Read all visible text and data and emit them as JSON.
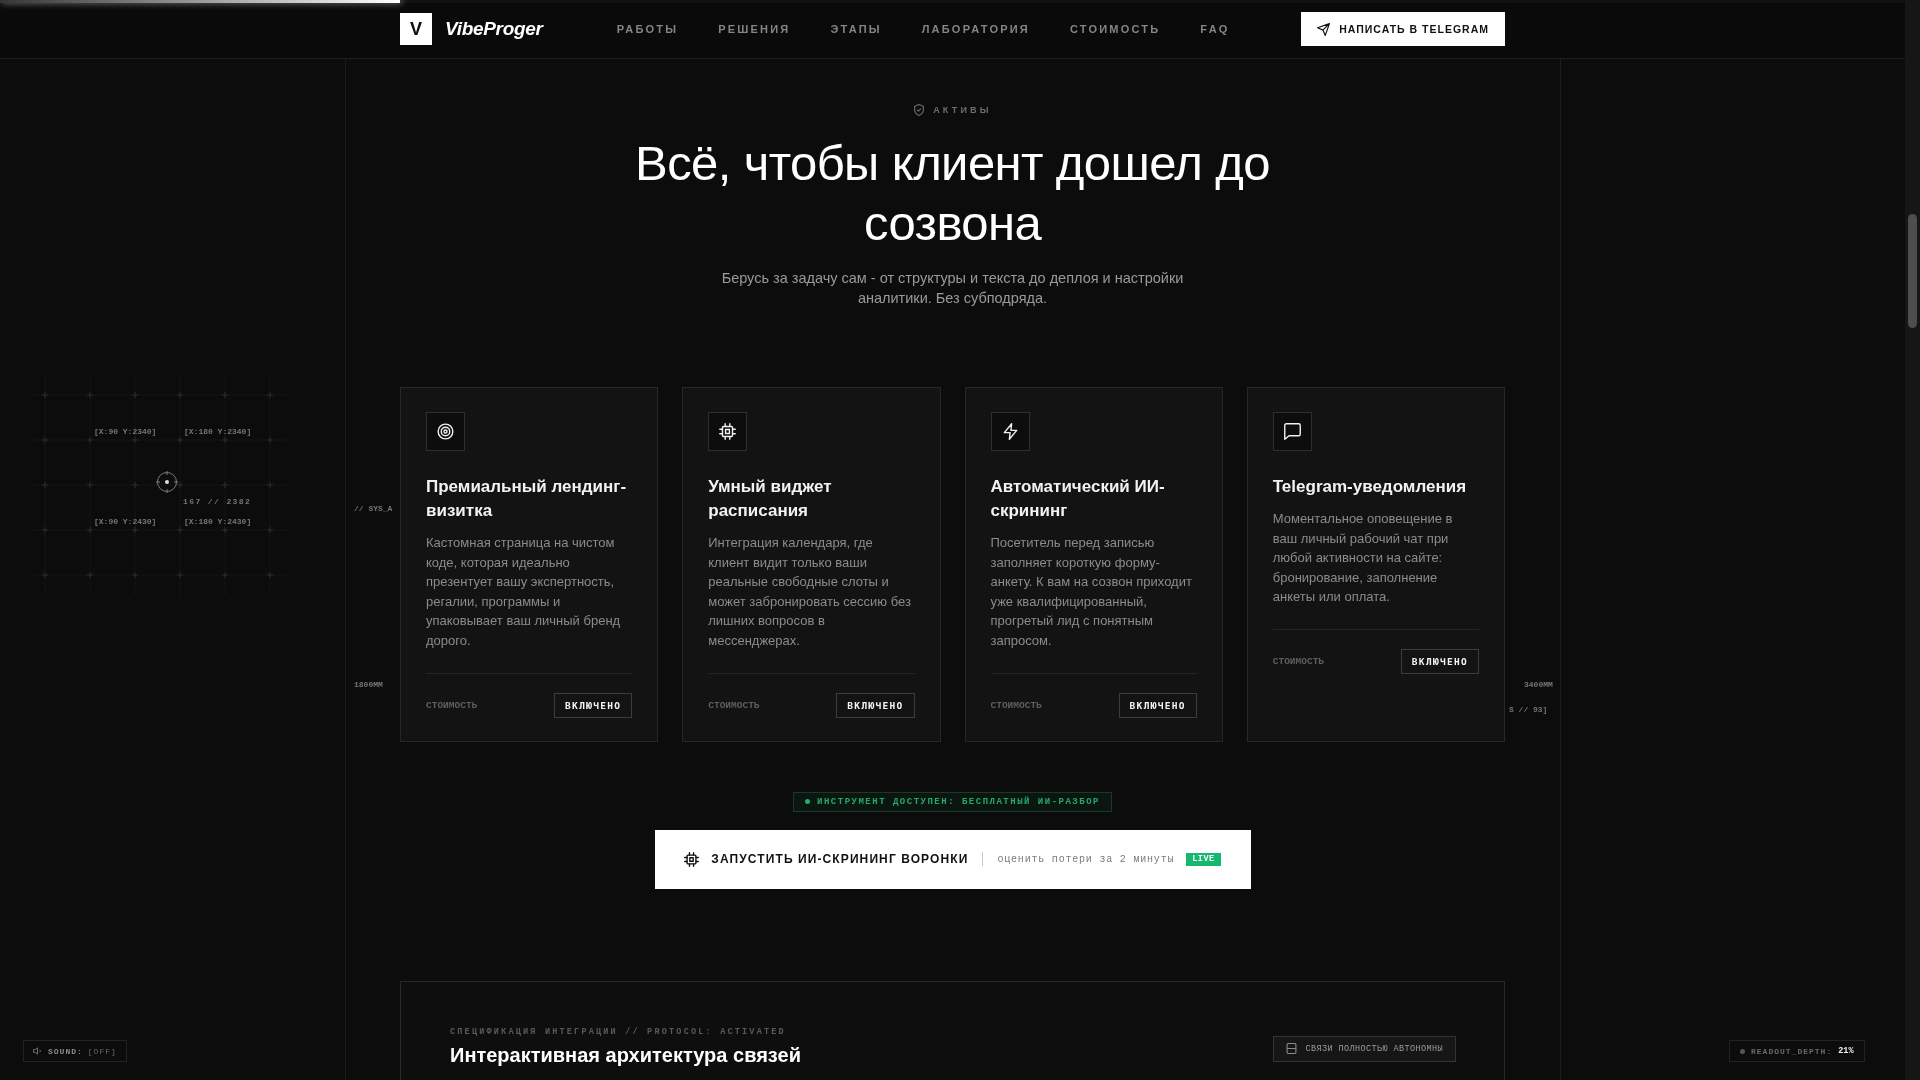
{
  "scroll_progress": {
    "level": 0.21
  },
  "header": {
    "logo_letter": "V",
    "brand": "VibeProger",
    "nav": [
      {
        "label": "РАБОТЫ"
      },
      {
        "label": "РЕШЕНИЯ"
      },
      {
        "label": "ЭТАПЫ"
      },
      {
        "label": "ЛАБОРАТОРИЯ"
      },
      {
        "label": "СТОИМОСТЬ"
      },
      {
        "label": "FAQ"
      }
    ],
    "cta": "НАПИСАТЬ В TELEGRAM"
  },
  "hud": {
    "coordinates": [
      "[X:90 Y:2340]",
      "[X:180 Y:2340]",
      "[X:90 Y:2430]",
      "[X:180 Y:2430]"
    ],
    "cursor_readout": "167 // 2382",
    "left_tag": "// SYS_A",
    "left_ruler": "1800MM",
    "right_ruler": "3400MM",
    "right_tag": "S // 93]"
  },
  "section": {
    "eyebrow": "АКТИВЫ",
    "title": "Всё, чтобы клиент дошел до созвона",
    "subtitle": "Берусь за задачу сам - от структуры и текста до деплоя и настройки аналитики. Без субподряда.",
    "cards": [
      {
        "title": "Премиальный лендинг-визитка",
        "description": "Кастомная страница на чистом коде, которая идеально презентует вашу экспертность, регалии, программы и упаковывает ваш личный бренд дорого.",
        "price_label": "СТОИМОСТЬ",
        "price": "ВКЛЮЧЕНО"
      },
      {
        "title": "Умный виджет расписания",
        "description": "Интеграция календаря, где клиент видит только ваши реальные свободные слоты и может забронировать сессию без лишних вопросов в мессенджерах.",
        "price_label": "СТОИМОСТЬ",
        "price": "ВКЛЮЧЕНО"
      },
      {
        "title": "Автоматический ИИ-скрининг",
        "description": "Посетитель перед записью заполняет короткую форму-анкету. К вам на созвон приходит уже квалифицированный, прогретый лид с понятным запросом.",
        "price_label": "СТОИМОСТЬ",
        "price": "ВКЛЮЧЕНО"
      },
      {
        "title": "Telegram-уведомления",
        "description": "Моментальное оповещение в ваш личный рабочий чат при любой активности на сайте: бронирование, заполнение анкеты или оплата.",
        "price_label": "СТОИМОСТЬ",
        "price": "ВКЛЮЧЕНО"
      }
    ]
  },
  "tool_badge": "ИНСТРУМЕНТ ДОСТУПЕН: БЕСПЛАТНЫЙ ИИ-РАЗБОР",
  "cta_bar": {
    "label": "ЗАПУСТИТЬ ИИ-СКРИНИНГ ВОРОНКИ",
    "hint": "оценить потери за 2 минуты",
    "badge": "LIVE"
  },
  "integration": {
    "eyebrow": "СПЕЦИФИКАЦИЯ ИНТЕГРАЦИИ // PROTOCOL: ACTIVATED",
    "title": "Интерактивная архитектура связей",
    "status": "СВЯЗИ ПОЛНОСТЬЮ АВТОНОМНЫ"
  },
  "sound": {
    "label": "SOUND:",
    "value": "[OFF]"
  },
  "readout": {
    "label": "READOUT_DEPTH:",
    "value": "21%"
  }
}
